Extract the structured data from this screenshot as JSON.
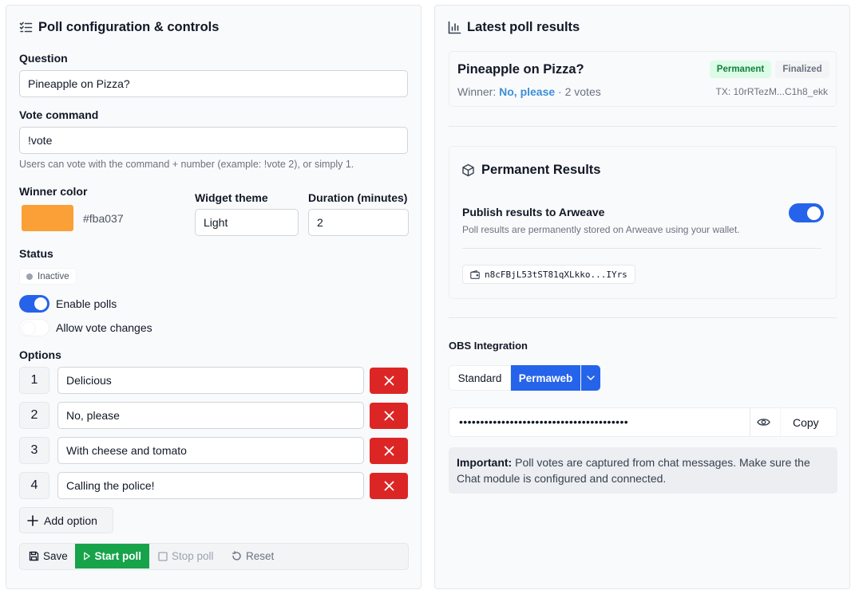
{
  "left": {
    "title": "Poll configuration & controls",
    "question": {
      "label": "Question",
      "value": "Pineapple on Pizza?"
    },
    "vote_command": {
      "label": "Vote command",
      "value": "!vote",
      "help": "Users can vote with the command + number (example: !vote 2), or simply 1."
    },
    "winner_color": {
      "label": "Winner color",
      "value": "#fba037"
    },
    "widget_theme": {
      "label": "Widget theme",
      "value": "Light"
    },
    "duration": {
      "label": "Duration (minutes)",
      "value": "2"
    },
    "status": {
      "label": "Status",
      "value": "Inactive"
    },
    "toggles": {
      "enable_polls": {
        "label": "Enable polls",
        "on": true
      },
      "allow_vote_changes": {
        "label": "Allow vote changes",
        "on": false
      }
    },
    "options": {
      "label": "Options",
      "items": [
        {
          "number": "1",
          "text": "Delicious"
        },
        {
          "number": "2",
          "text": "No, please"
        },
        {
          "number": "3",
          "text": "With cheese and tomato"
        },
        {
          "number": "4",
          "text": "Calling the police!"
        }
      ],
      "add_label": "Add option"
    },
    "actions": {
      "save": "Save",
      "start": "Start poll",
      "stop": "Stop poll",
      "reset": "Reset"
    }
  },
  "right": {
    "title": "Latest poll results",
    "result": {
      "question": "Pineapple on Pizza?",
      "badge_permanent": "Permanent",
      "badge_finalized": "Finalized",
      "winner_prefix": "Winner:",
      "winner": "No, please",
      "votes": "· 2 votes",
      "tx": "TX: 10rRTezM...C1h8_ekk"
    },
    "permanent": {
      "title": "Permanent Results",
      "publish_label": "Publish results to Arweave",
      "publish_on": true,
      "help": "Poll results are permanently stored on Arweave using your wallet.",
      "wallet": "n8cFBjL53tST81qXLkko...IYrs"
    },
    "obs": {
      "label": "OBS Integration",
      "tab_standard": "Standard",
      "tab_permaweb": "Permaweb",
      "url_masked": "••••••••••••••••••••••••••••••••••••••••",
      "copy": "Copy"
    },
    "notice": {
      "strong": "Important:",
      "text": " Poll votes are captured from chat messages. Make sure the Chat module is configured and connected."
    }
  },
  "colors": {
    "accent": "#2563eb",
    "danger": "#dc2626",
    "success": "#16a34a",
    "winner_swatch": "#fba037",
    "link": "#3b8fd9"
  }
}
